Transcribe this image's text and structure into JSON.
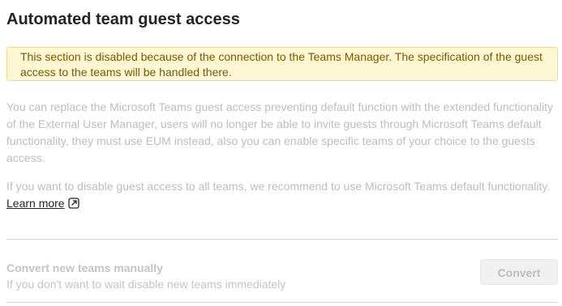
{
  "header": {
    "title": "Automated team guest access"
  },
  "warning": {
    "text": "This section is disabled because of the connection to the Teams Manager. The specification of the guest access to the teams will be handled there."
  },
  "description": {
    "paragraph1": "You can replace the Microsoft Teams guest access preventing default function with the extended functionality of the External User Manager, users will no longer be able to invite guests through Microsoft Teams default functionality, they must use EUM instead, also you can enable specific teams of your choice to the guests access.",
    "paragraph2": "If you want to disable guest access to all teams, we recommend to use Microsoft Teams default functionality.",
    "learn_more": "Learn more",
    "learn_more_icon": "external-link-icon"
  },
  "convert_section": {
    "title": "Convert new teams manually",
    "subtitle": "If you don't want to wait disable new teams immediately",
    "button_label": "Convert",
    "button_disabled": true
  },
  "colors": {
    "warning_bg": "#fdf8d3",
    "warning_border": "#ecdc8a",
    "warning_text": "#7a5a00",
    "disabled_text": "#bdbdbd"
  }
}
